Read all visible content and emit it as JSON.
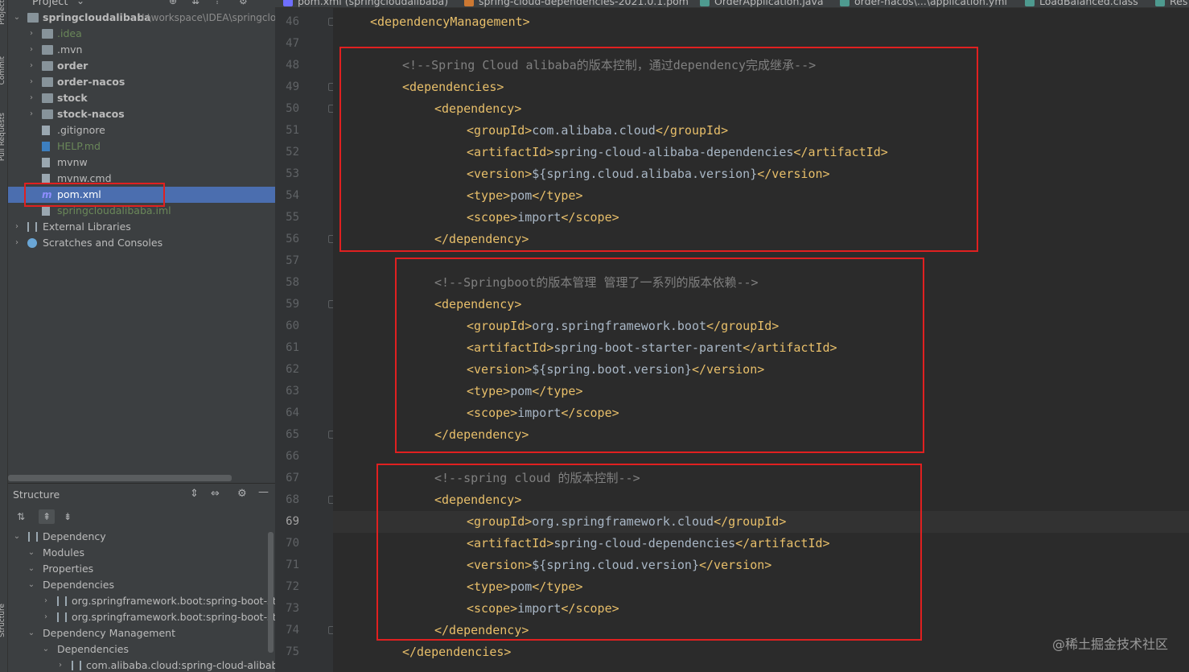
{
  "window_tabs": [
    {
      "label": "pom.xml (springcloudalibaba)",
      "icon": "maven-icon",
      "color": "#6f6fff"
    },
    {
      "label": "spring-cloud-dependencies-2021.0.1.pom",
      "icon": "pom-icon",
      "color": "#cc7832"
    },
    {
      "label": "OrderApplication.java",
      "icon": "java-class-icon",
      "color": "#4e9a8f"
    },
    {
      "label": "order-nacos\\...\\application.yml",
      "icon": "yaml-icon",
      "color": "#4e9a8f"
    },
    {
      "label": "LoadBalanced.class",
      "icon": "class-icon",
      "color": "#4e9a8f"
    },
    {
      "label": "Res",
      "icon": "class-icon",
      "color": "#4e9a8f"
    }
  ],
  "project_panel": {
    "title": "Project",
    "root": {
      "name": "springcloudalibaba",
      "path": "I:\\workspace\\IDEA\\springcloudalibaba"
    },
    "items": [
      {
        "label": ".idea",
        "indent": 2,
        "kind": "folder",
        "arrow": "›",
        "color": "#6a8759",
        "bold": false
      },
      {
        "label": ".mvn",
        "indent": 2,
        "kind": "folder",
        "arrow": "›",
        "color": "#bbbbbb",
        "bold": false
      },
      {
        "label": "order",
        "indent": 2,
        "kind": "module",
        "arrow": "›",
        "color": "#bbbbbb",
        "bold": true
      },
      {
        "label": "order-nacos",
        "indent": 2,
        "kind": "module",
        "arrow": "›",
        "color": "#bbbbbb",
        "bold": true
      },
      {
        "label": "stock",
        "indent": 2,
        "kind": "module",
        "arrow": "›",
        "color": "#bbbbbb",
        "bold": true
      },
      {
        "label": "stock-nacos",
        "indent": 2,
        "kind": "module",
        "arrow": "›",
        "color": "#bbbbbb",
        "bold": true
      },
      {
        "label": ".gitignore",
        "indent": 2,
        "kind": "file",
        "arrow": "",
        "color": "#bbbbbb",
        "bold": false
      },
      {
        "label": "HELP.md",
        "indent": 2,
        "kind": "md",
        "arrow": "",
        "color": "#6a8759",
        "bold": false
      },
      {
        "label": "mvnw",
        "indent": 2,
        "kind": "script",
        "arrow": "",
        "color": "#bbbbbb",
        "bold": false
      },
      {
        "label": "mvnw.cmd",
        "indent": 2,
        "kind": "file",
        "arrow": "",
        "color": "#bbbbbb",
        "bold": false
      },
      {
        "label": "pom.xml",
        "indent": 2,
        "kind": "maven",
        "arrow": "",
        "color": "#ffffff",
        "bold": false,
        "selected": true
      },
      {
        "label": "springcloudalibaba.iml",
        "indent": 2,
        "kind": "iml",
        "arrow": "",
        "color": "#6a8759",
        "bold": false
      },
      {
        "label": "External Libraries",
        "indent": 1,
        "kind": "library",
        "arrow": "›",
        "color": "#bbbbbb",
        "bold": false
      },
      {
        "label": "Scratches and Consoles",
        "indent": 1,
        "kind": "scratch",
        "arrow": "›",
        "color": "#bbbbbb",
        "bold": false
      }
    ]
  },
  "structure_panel": {
    "title": "Structure",
    "items": [
      {
        "label": "Dependency",
        "indent": 0,
        "arrow": "⌄",
        "icon": "library"
      },
      {
        "label": "Modules",
        "indent": 1,
        "arrow": "⌄",
        "icon": ""
      },
      {
        "label": "Properties",
        "indent": 1,
        "arrow": "⌄",
        "icon": ""
      },
      {
        "label": "Dependencies",
        "indent": 1,
        "arrow": "⌄",
        "icon": ""
      },
      {
        "label": "org.springframework.boot:spring-boot-starter",
        "indent": 2,
        "arrow": "›",
        "icon": "library"
      },
      {
        "label": "org.springframework.boot:spring-boot-starter",
        "indent": 2,
        "arrow": "›",
        "icon": "library"
      },
      {
        "label": "Dependency Management",
        "indent": 1,
        "arrow": "⌄",
        "icon": ""
      },
      {
        "label": "Dependencies",
        "indent": 2,
        "arrow": "⌄",
        "icon": ""
      },
      {
        "label": "com.alibaba.cloud:spring-cloud-alibaba-dependencies",
        "indent": 3,
        "arrow": "›",
        "icon": "library"
      }
    ]
  },
  "editor": {
    "current_line": 69,
    "lines": [
      {
        "num": 46,
        "indent": 1,
        "segs": [
          {
            "t": "tag",
            "v": "<dependencyManagement>"
          }
        ]
      },
      {
        "num": 47,
        "indent": 0,
        "segs": []
      },
      {
        "num": 48,
        "indent": 2,
        "segs": [
          {
            "t": "cmt",
            "v": "<!--Spring Cloud alibaba的版本控制，通过dependency完成继承-->"
          }
        ]
      },
      {
        "num": 49,
        "indent": 2,
        "segs": [
          {
            "t": "tag",
            "v": "<dependencies>"
          }
        ]
      },
      {
        "num": 50,
        "indent": 3,
        "segs": [
          {
            "t": "tag",
            "v": "<dependency>"
          }
        ]
      },
      {
        "num": 51,
        "indent": 4,
        "segs": [
          {
            "t": "tag",
            "v": "<groupId>"
          },
          {
            "t": "txt",
            "v": "com.alibaba.cloud"
          },
          {
            "t": "tag",
            "v": "</groupId>"
          }
        ]
      },
      {
        "num": 52,
        "indent": 4,
        "segs": [
          {
            "t": "tag",
            "v": "<artifactId>"
          },
          {
            "t": "txt",
            "v": "spring-cloud-alibaba-dependencies"
          },
          {
            "t": "tag",
            "v": "</artifactId>"
          }
        ]
      },
      {
        "num": 53,
        "indent": 4,
        "segs": [
          {
            "t": "tag",
            "v": "<version>"
          },
          {
            "t": "txt",
            "v": "${spring.cloud.alibaba.version}"
          },
          {
            "t": "tag",
            "v": "</version>"
          }
        ]
      },
      {
        "num": 54,
        "indent": 4,
        "segs": [
          {
            "t": "tag",
            "v": "<type>"
          },
          {
            "t": "txt",
            "v": "pom"
          },
          {
            "t": "tag",
            "v": "</type>"
          }
        ]
      },
      {
        "num": 55,
        "indent": 4,
        "segs": [
          {
            "t": "tag",
            "v": "<scope>"
          },
          {
            "t": "txt",
            "v": "import"
          },
          {
            "t": "tag",
            "v": "</scope>"
          }
        ]
      },
      {
        "num": 56,
        "indent": 3,
        "segs": [
          {
            "t": "tag",
            "v": "</dependency>"
          }
        ]
      },
      {
        "num": 57,
        "indent": 0,
        "segs": []
      },
      {
        "num": 58,
        "indent": 3,
        "segs": [
          {
            "t": "cmt",
            "v": "<!--Springboot的版本管理 管理了一系列的版本依赖-->"
          }
        ]
      },
      {
        "num": 59,
        "indent": 3,
        "segs": [
          {
            "t": "tag",
            "v": "<dependency>"
          }
        ]
      },
      {
        "num": 60,
        "indent": 4,
        "segs": [
          {
            "t": "tag",
            "v": "<groupId>"
          },
          {
            "t": "txt",
            "v": "org.springframework.boot"
          },
          {
            "t": "tag",
            "v": "</groupId>"
          }
        ]
      },
      {
        "num": 61,
        "indent": 4,
        "segs": [
          {
            "t": "tag",
            "v": "<artifactId>"
          },
          {
            "t": "txt",
            "v": "spring-boot-starter-parent"
          },
          {
            "t": "tag",
            "v": "</artifactId>"
          }
        ]
      },
      {
        "num": 62,
        "indent": 4,
        "segs": [
          {
            "t": "tag",
            "v": "<version>"
          },
          {
            "t": "txt",
            "v": "${spring.boot.version}"
          },
          {
            "t": "tag",
            "v": "</version>"
          }
        ]
      },
      {
        "num": 63,
        "indent": 4,
        "segs": [
          {
            "t": "tag",
            "v": "<type>"
          },
          {
            "t": "txt",
            "v": "pom"
          },
          {
            "t": "tag",
            "v": "</type>"
          }
        ]
      },
      {
        "num": 64,
        "indent": 4,
        "segs": [
          {
            "t": "tag",
            "v": "<scope>"
          },
          {
            "t": "txt",
            "v": "import"
          },
          {
            "t": "tag",
            "v": "</scope>"
          }
        ]
      },
      {
        "num": 65,
        "indent": 3,
        "segs": [
          {
            "t": "tag",
            "v": "</dependency>"
          }
        ]
      },
      {
        "num": 66,
        "indent": 0,
        "segs": []
      },
      {
        "num": 67,
        "indent": 3,
        "segs": [
          {
            "t": "cmt",
            "v": "<!--spring cloud 的版本控制-->"
          }
        ]
      },
      {
        "num": 68,
        "indent": 3,
        "segs": [
          {
            "t": "tag",
            "v": "<dependency>"
          }
        ]
      },
      {
        "num": 69,
        "indent": 4,
        "segs": [
          {
            "t": "tag",
            "v": "<groupId>"
          },
          {
            "t": "txt",
            "v": "org.springframework.cloud"
          },
          {
            "t": "tag",
            "v": "</groupId>"
          }
        ]
      },
      {
        "num": 70,
        "indent": 4,
        "segs": [
          {
            "t": "tag",
            "v": "<artifactId>"
          },
          {
            "t": "txt",
            "v": "spring-cloud-dependencies"
          },
          {
            "t": "tag",
            "v": "</artifactId>"
          }
        ]
      },
      {
        "num": 71,
        "indent": 4,
        "segs": [
          {
            "t": "tag",
            "v": "<version>"
          },
          {
            "t": "txt",
            "v": "${spring.cloud.version}"
          },
          {
            "t": "tag",
            "v": "</version>"
          }
        ]
      },
      {
        "num": 72,
        "indent": 4,
        "segs": [
          {
            "t": "tag",
            "v": "<type>"
          },
          {
            "t": "txt",
            "v": "pom"
          },
          {
            "t": "tag",
            "v": "</type>"
          }
        ]
      },
      {
        "num": 73,
        "indent": 4,
        "segs": [
          {
            "t": "tag",
            "v": "<scope>"
          },
          {
            "t": "txt",
            "v": "import"
          },
          {
            "t": "tag",
            "v": "</scope>"
          }
        ]
      },
      {
        "num": 74,
        "indent": 3,
        "segs": [
          {
            "t": "tag",
            "v": "</dependency>"
          }
        ]
      },
      {
        "num": 75,
        "indent": 2,
        "segs": [
          {
            "t": "tag",
            "v": "</dependencies>"
          }
        ]
      }
    ]
  },
  "watermark": "@稀土掘金技术社区",
  "side_labels": {
    "project": "Project",
    "commit": "Commit",
    "pull_requests": "Pull Requests",
    "structure": "Structure"
  },
  "colors": {
    "highlight_box": "#e02020",
    "selection": "#4b6eaf",
    "tag": "#e8bf6a",
    "text": "#a9b7c6",
    "comment": "#808080"
  }
}
